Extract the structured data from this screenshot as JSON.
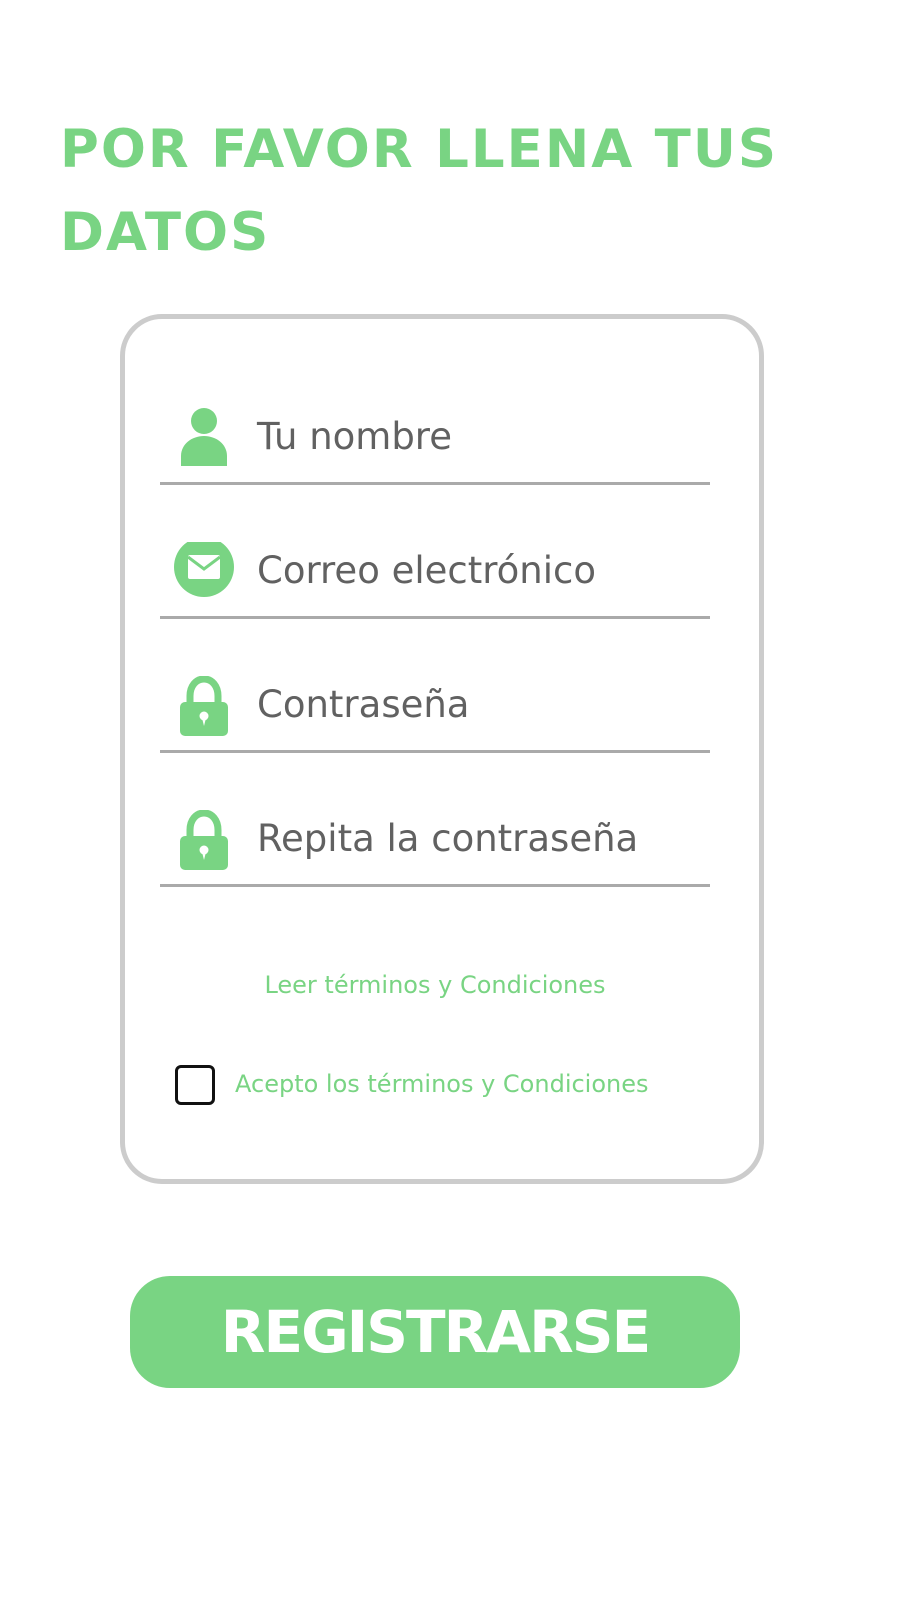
{
  "header": {
    "title": "POR FAVOR LLENA TUS DATOS"
  },
  "form": {
    "fields": [
      {
        "placeholder": "Tu nombre",
        "icon": "user-icon"
      },
      {
        "placeholder": "Correo electrónico",
        "icon": "mail-icon"
      },
      {
        "placeholder": "Contraseña",
        "icon": "lock-icon"
      },
      {
        "placeholder": "Repita la contraseña",
        "icon": "lock-icon"
      }
    ],
    "terms_link": "Leer términos y Condiciones",
    "accept_label": "Acepto los términos y Condiciones",
    "accept_checked": false
  },
  "actions": {
    "register_label": "REGISTRARSE"
  },
  "colors": {
    "accent": "#79d483",
    "field_text": "#616161",
    "card_border": "#cccccc",
    "field_line": "#aaaaaa"
  }
}
